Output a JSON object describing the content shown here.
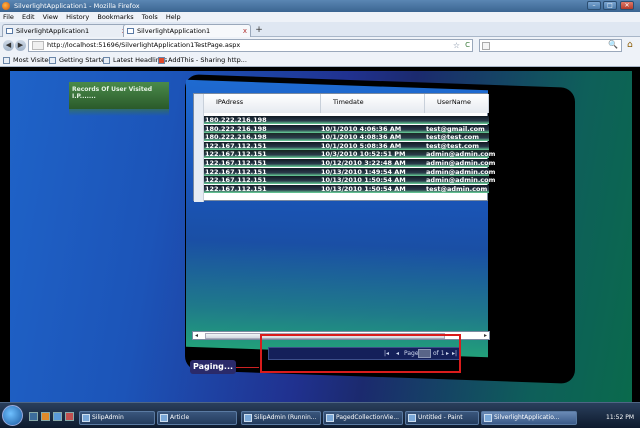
{
  "window": {
    "title": "SilverlightApplication1 - Mozilla Firefox",
    "min": "–",
    "max": "□",
    "close": "✕"
  },
  "menu": [
    "File",
    "Edit",
    "View",
    "History",
    "Bookmarks",
    "Tools",
    "Help"
  ],
  "tabs": [
    {
      "label": "SilverlightApplication1",
      "close": "x"
    },
    {
      "label": "SilverlightApplication1",
      "close": "x"
    }
  ],
  "new_tab": "+",
  "nav": {
    "back": "◀",
    "forward": "▶",
    "url": "http://localhost:51696/SilverlightApplication1TestPage.aspx",
    "star": "☆",
    "reload": "C",
    "search_mag": "🔍",
    "home": "⌂"
  },
  "bookmarks": [
    "Most Visited",
    "Getting Started",
    "Latest Headlines",
    "AddThis - Sharing http..."
  ],
  "app": {
    "title_badge": "Records Of User Visited I.P.......",
    "paging_label": "Paging...",
    "grid": {
      "columns": [
        "IPAdress",
        "Timedate",
        "UserName"
      ],
      "rows": [
        {
          "ip": "180.222.216.198",
          "time": "",
          "user": ""
        },
        {
          "ip": "180.222.216.198",
          "time": "10/1/2010 4:06:36 AM",
          "user": "test@gmail.com"
        },
        {
          "ip": "180.222.216.198",
          "time": "10/1/2010 4:08:36 AM",
          "user": "test@test.com"
        },
        {
          "ip": "122.167.112.151",
          "time": "10/1/2010 5:08:36 AM",
          "user": "test@test.com"
        },
        {
          "ip": "122.167.112.151",
          "time": "10/3/2010 10:52:51 PM",
          "user": "admin@admin.com"
        },
        {
          "ip": "122.167.112.151",
          "time": "10/12/2010 3:22:48 AM",
          "user": "admin@admin.com"
        },
        {
          "ip": "122.167.112.151",
          "time": "10/13/2010 1:49:54 AM",
          "user": "admin@admin.com"
        },
        {
          "ip": "122.167.112.151",
          "time": "10/13/2010 1:50:54 AM",
          "user": "admin@admin.com"
        },
        {
          "ip": "122.167.112.151",
          "time": "10/13/2010 1:50:54 AM",
          "user": "test@admin.com"
        }
      ],
      "scroll_left": "◂",
      "scroll_right": "▸"
    },
    "pager": {
      "first": "|◂",
      "prev": "◂",
      "page_label": "Page",
      "of_label": "of 1",
      "next": "▸",
      "last": "▸|"
    }
  },
  "taskbar": {
    "items": [
      {
        "label": "SilipAdmin"
      },
      {
        "label": "Article"
      },
      {
        "label": "SilipAdmin (Runnin..."
      },
      {
        "label": "PagedCollectionVie..."
      },
      {
        "label": "Untitled - Paint"
      },
      {
        "label": "SilverlightApplicatio..."
      }
    ],
    "clock": "11:52 PM"
  }
}
